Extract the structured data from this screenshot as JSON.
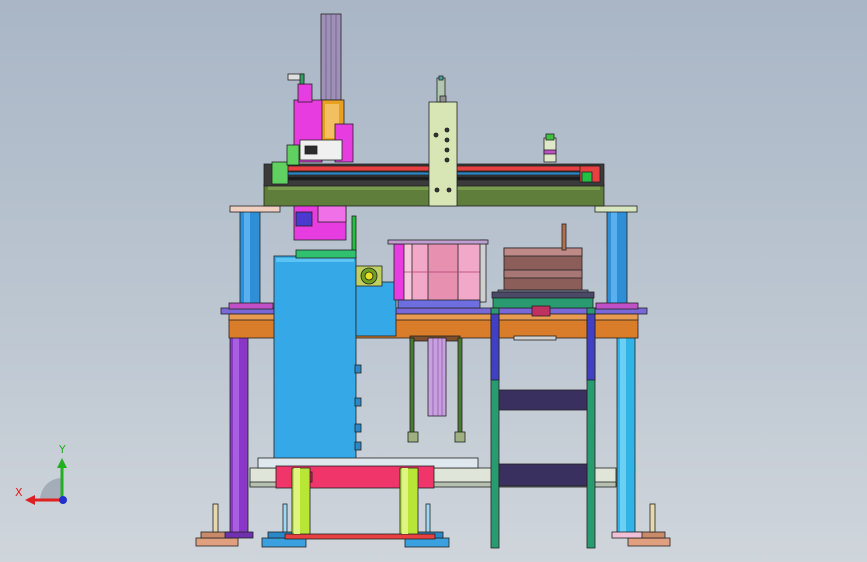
{
  "triad": {
    "x_label": "X",
    "y_label": "Y",
    "x_color": "#e02020",
    "y_color": "#20b020",
    "z_color": "#2030d0"
  },
  "colors": {
    "background_top": "#a9b6c6",
    "background_bottom": "#cfd5db",
    "frame_blue": "#2e8fd6",
    "table_orange": "#d97d2a",
    "gantry_green": "#5f7d3b",
    "magenta": "#e63ce0",
    "pink": "#f2a8c8",
    "cyan_panel": "#35a9e8",
    "leg_purple": "#8a37c8",
    "leg_lightblue": "#2fb4e8",
    "teal_frame": "#2a9a70",
    "lime": "#b8e636",
    "bronze": "#8c5e5a",
    "khaki": "#d7e6b4"
  }
}
